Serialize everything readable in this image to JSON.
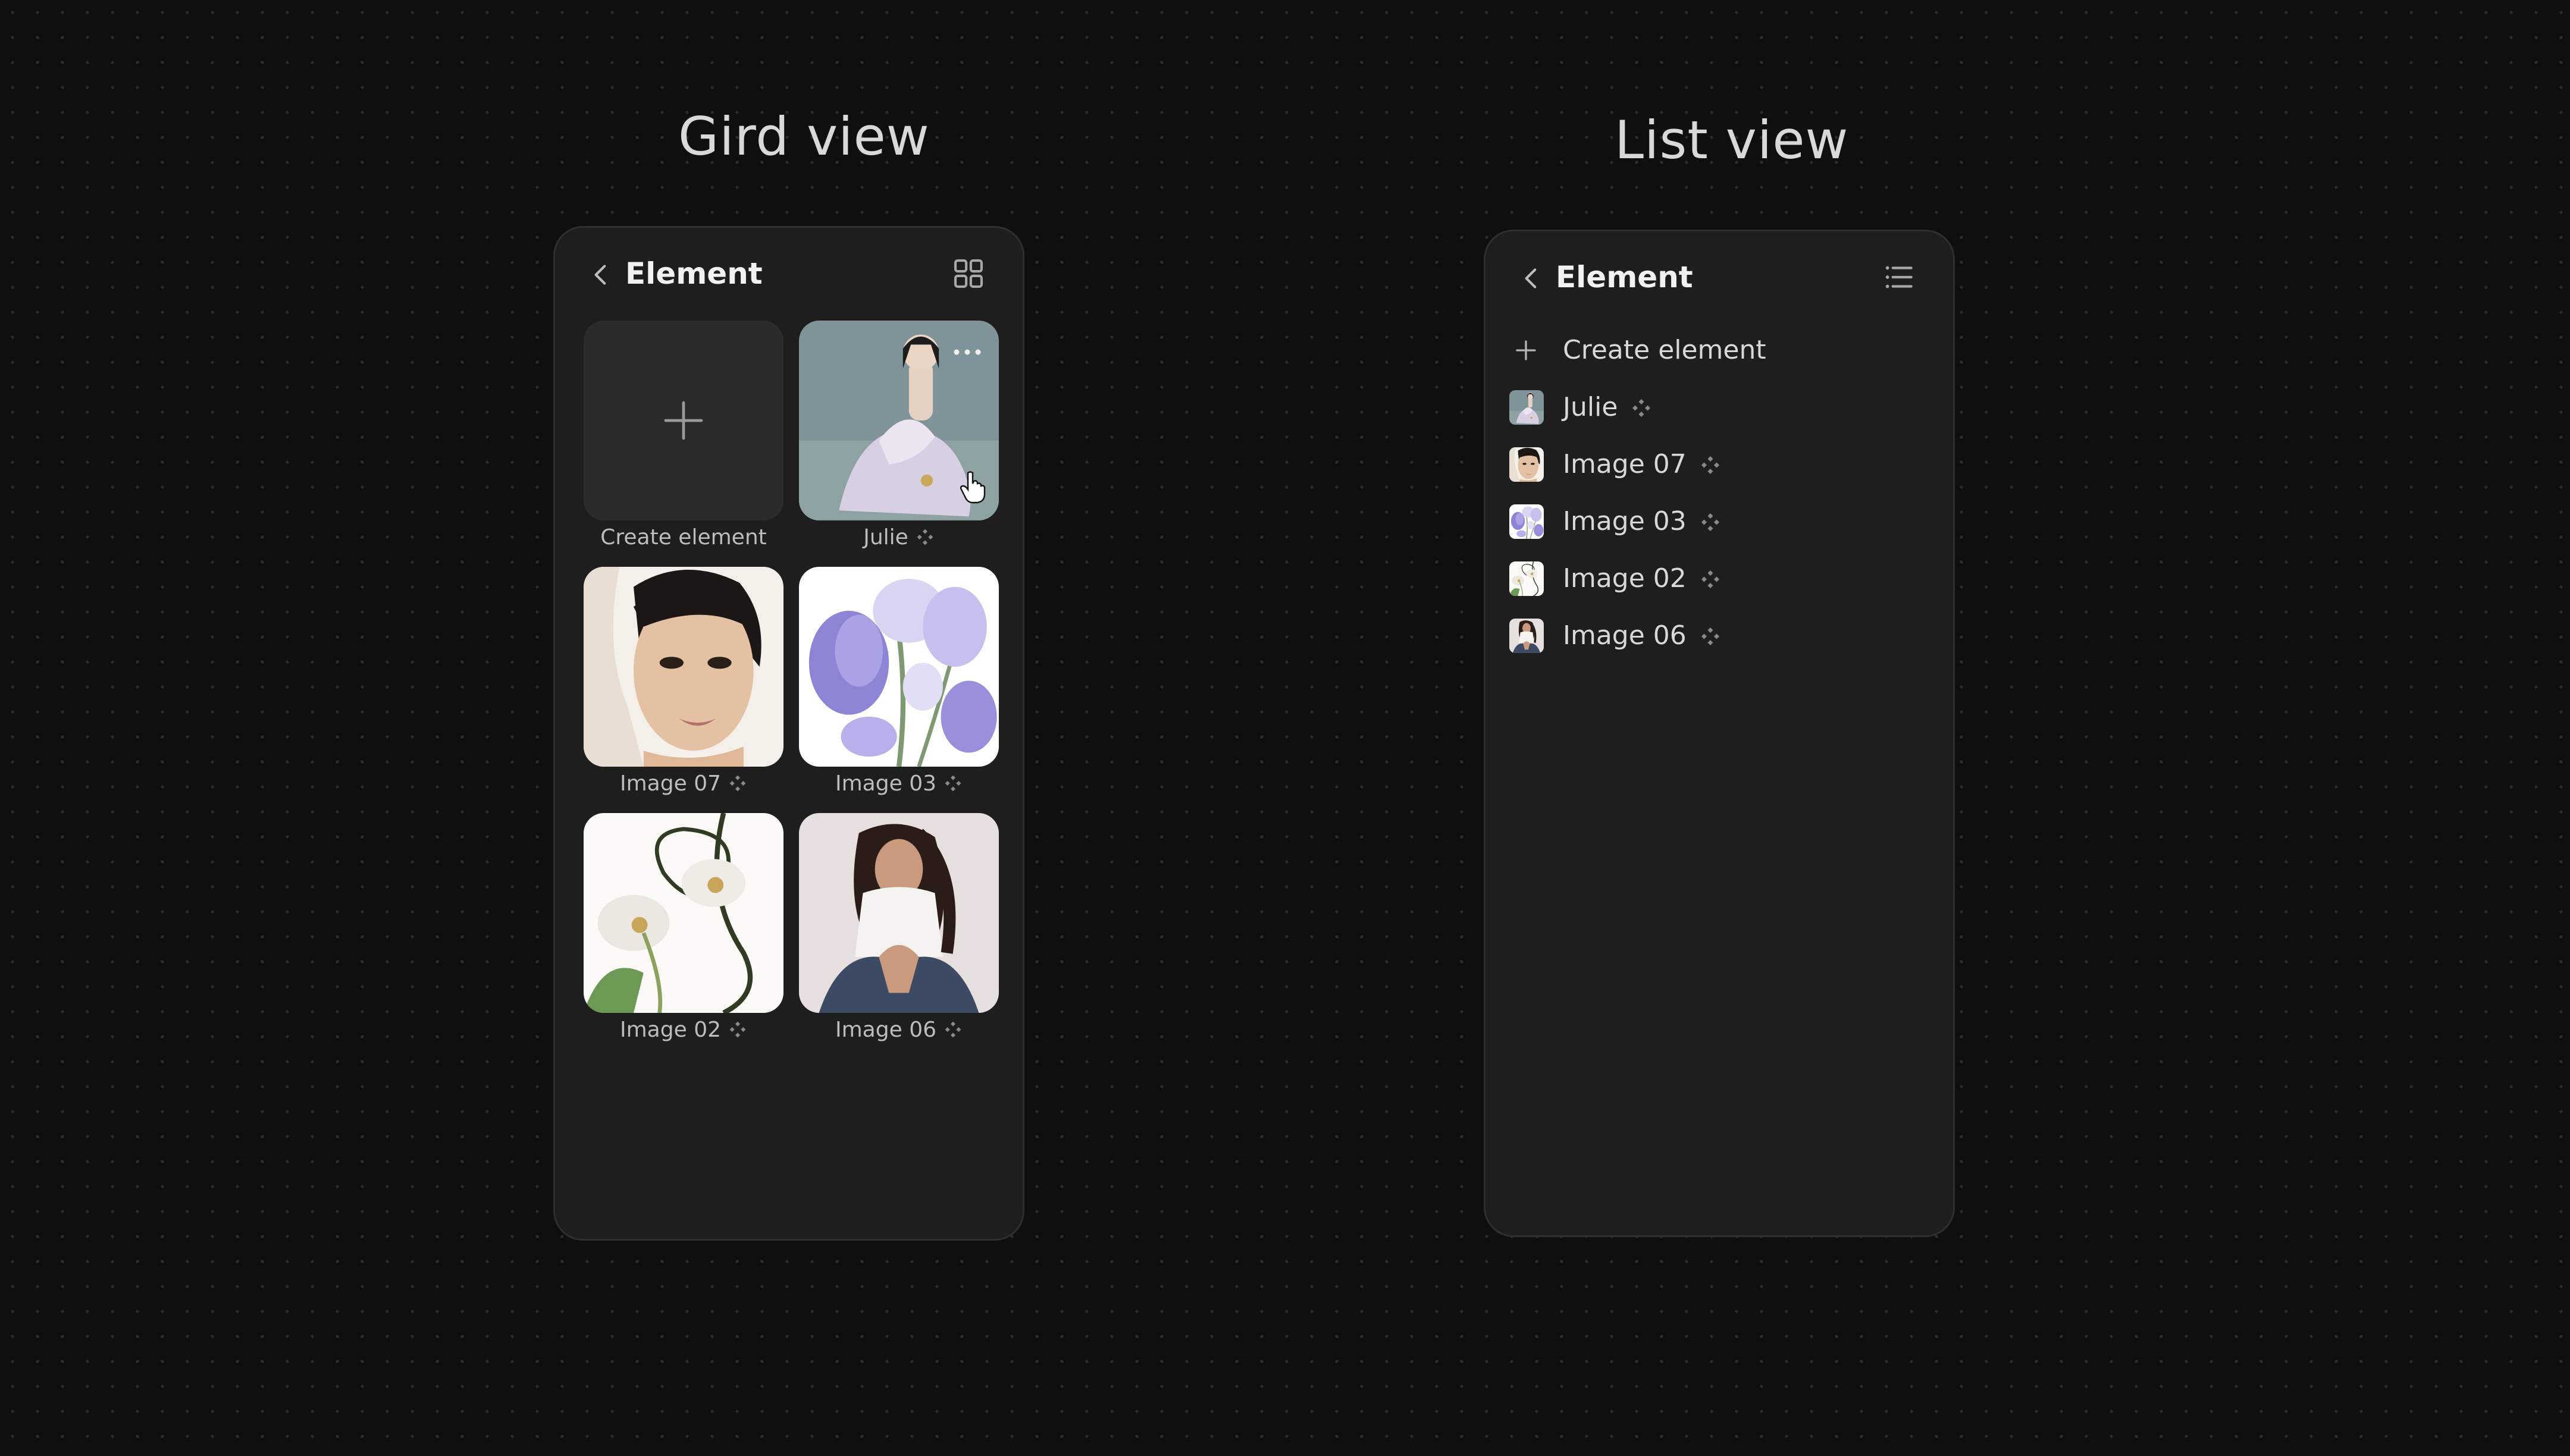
{
  "grid_view": {
    "heading": "Gird view",
    "title": "Element",
    "create_label": "Create element",
    "items": [
      {
        "label": "Julie",
        "thumb": "woman-lavender-dress"
      },
      {
        "label": "Image 07",
        "thumb": "woman-portrait"
      },
      {
        "label": "Image 03",
        "thumb": "purple-sweet-pea"
      },
      {
        "label": "Image 02",
        "thumb": "white-orchid"
      },
      {
        "label": "Image 06",
        "thumb": "woman-seated-jeans"
      }
    ]
  },
  "list_view": {
    "heading": "List view",
    "title": "Element",
    "create_label": "Create element",
    "items": [
      {
        "label": "Julie"
      },
      {
        "label": "Image 07"
      },
      {
        "label": "Image 03"
      },
      {
        "label": "Image 02"
      },
      {
        "label": "Image 06"
      }
    ]
  },
  "icons": [
    "chevron-left-icon",
    "grid-icon",
    "list-icon",
    "plus-icon",
    "component-icon",
    "more-icon",
    "hand-cursor-icon"
  ],
  "colors": {
    "background": "#0f0f0f",
    "panel": "#1e1e1e",
    "text": "#e8e8e8",
    "muted": "#bdbdbd"
  }
}
